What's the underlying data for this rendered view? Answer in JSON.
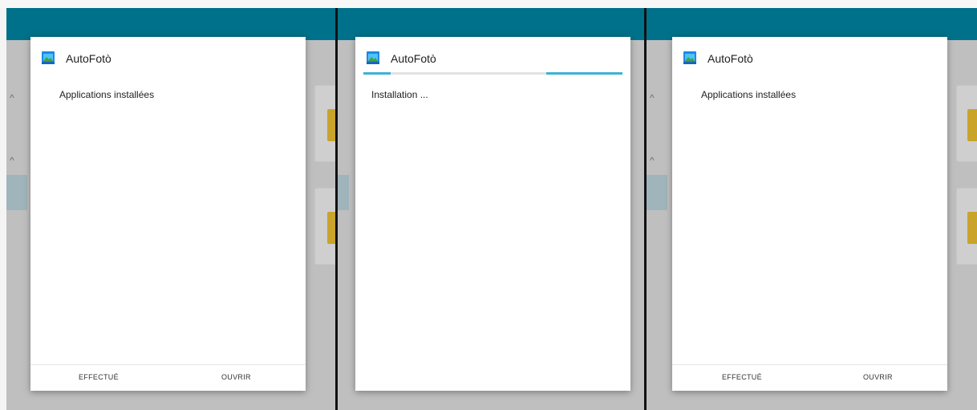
{
  "colors": {
    "accent": "#00718a",
    "progress": "#3fb0d8"
  },
  "app": {
    "name": "AutoFotò",
    "icon": "app-photo-icon"
  },
  "screens": [
    {
      "message": "Applications installées",
      "done_label": "EFFECTUÉ",
      "open_label": "OUVRIR"
    },
    {
      "message": "Installation ...",
      "progress_indeterminate": true
    },
    {
      "message": "Applications installées",
      "done_label": "EFFECTUÉ",
      "open_label": "OUVRIR"
    }
  ]
}
